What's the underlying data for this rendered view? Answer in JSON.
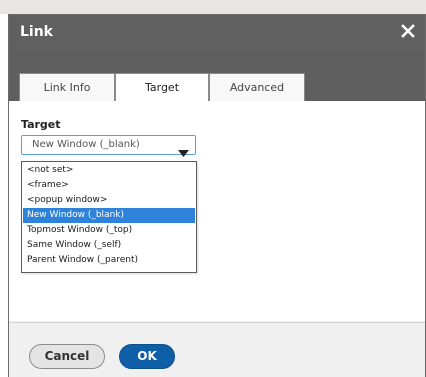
{
  "dialog": {
    "title": "Link",
    "close_icon": "close-icon"
  },
  "tabs": [
    {
      "label": "Link Info"
    },
    {
      "label": "Target",
      "active": true
    },
    {
      "label": "Advanced"
    }
  ],
  "target": {
    "label": "Target",
    "selected_value": "New Window (_blank)",
    "options": [
      "<not set>",
      "<frame>",
      "<popup window>",
      "New Window (_blank)",
      "Topmost Window (_top)",
      "Same Window (_self)",
      "Parent Window (_parent)"
    ],
    "selected_index": 3
  },
  "footer": {
    "cancel_label": "Cancel",
    "ok_label": "OK"
  },
  "colors": {
    "titlebar": "#606060",
    "selection": "#2f82d9",
    "ok_button": "#0f5fa8",
    "select_border": "#5aa0d8"
  }
}
